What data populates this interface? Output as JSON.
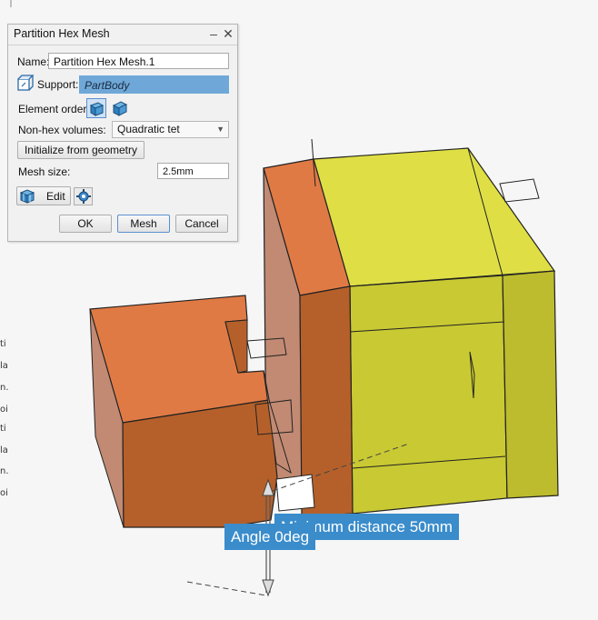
{
  "dialog": {
    "title": "Partition Hex Mesh",
    "minimize_label": "–",
    "close_label": "✕",
    "name_label": "Name:",
    "name_value": "Partition Hex Mesh.1",
    "support_label": "Support:",
    "support_value": "PartBody",
    "element_order_label": "Element order:",
    "element_order_options": [
      "linear-hex-icon",
      "quadratic-hex-icon"
    ],
    "non_hex_label": "Non-hex volumes:",
    "non_hex_value": "Quadratic tet",
    "initialize_label": "Initialize from geometry",
    "mesh_size_label": "Mesh size:",
    "mesh_size_value": "2.5mm",
    "edit_label": "Edit",
    "ok_label": "OK",
    "mesh_label": "Mesh",
    "cancel_label": "Cancel"
  },
  "left_strip": [
    "ti",
    "la",
    "n.",
    "oi",
    "ti",
    "la",
    "n.",
    "oi"
  ],
  "viewport": {
    "measure_distance": "Minimum distance 50mm",
    "measure_angle": "Angle 0deg"
  },
  "colors": {
    "orange_face": "#e07a45",
    "orange_dark": "#b5602a",
    "orange_side": "#c28a73",
    "yellow_top": "#dfdf45",
    "yellow_front": "#c9c933",
    "yellow_side": "#bcbc2e",
    "tag_blue": "#3a8ccb",
    "support_highlight": "#6fa8d8"
  }
}
